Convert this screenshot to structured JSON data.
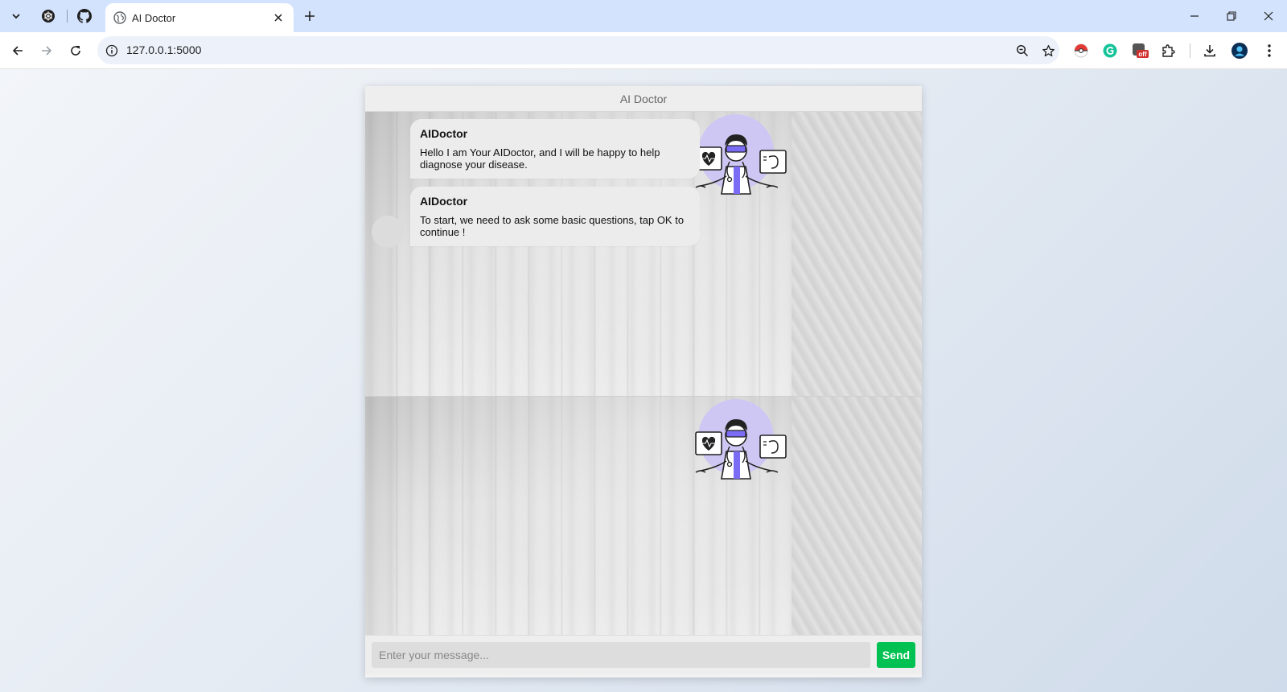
{
  "browser": {
    "tab_title": "AI Doctor",
    "url": "127.0.0.1:5000",
    "extension_badge": "off"
  },
  "app": {
    "header_title": "AI Doctor",
    "messages": [
      {
        "sender": "AIDoctor",
        "text": "Hello I am Your AIDoctor, and I will be happy to help diagnose your disease."
      },
      {
        "sender": "AIDoctor",
        "text": "To start, we need to ask some basic questions, tap OK to continue !"
      }
    ],
    "input_placeholder": "Enter your message...",
    "send_label": "Send",
    "colors": {
      "send_button": "#00c151",
      "doctor_accent": "#7b6cf6",
      "doctor_halo": "#cfc7f3"
    }
  },
  "icons": [
    "tab-search-icon",
    "openai-icon",
    "github-icon",
    "globe-icon",
    "close-icon",
    "plus-icon",
    "minimize-icon",
    "restore-icon",
    "back-icon",
    "forward-icon",
    "reload-icon",
    "info-icon",
    "zoom-icon",
    "star-icon",
    "extensions-icon",
    "download-icon",
    "profile-icon",
    "more-icon"
  ]
}
